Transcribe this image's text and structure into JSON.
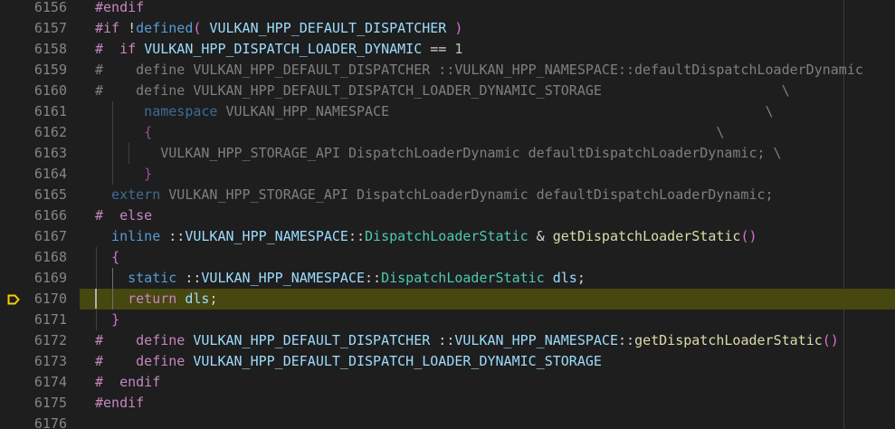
{
  "colors": {
    "background": "#1e1e1e",
    "current_line": "#474710",
    "line_number": "#858585",
    "debug_arrow": "#ffcc00"
  },
  "gutter": {
    "breakpoint_icon": "debug-stackframe-icon",
    "line_numbers": [
      "6156",
      "6157",
      "6158",
      "6159",
      "6160",
      "6161",
      "6162",
      "6163",
      "6164",
      "6165",
      "6166",
      "6167",
      "6168",
      "6169",
      "6170",
      "6171",
      "6172",
      "6173",
      "6174",
      "6175",
      "6176"
    ]
  },
  "lines": [
    {
      "tokens": [
        {
          "t": "#endif",
          "c": "#c586c0"
        }
      ]
    },
    {
      "tokens": [
        {
          "t": "#if",
          "c": "#c586c0"
        },
        {
          "t": " ",
          "c": "#d4d4d4"
        },
        {
          "t": "!",
          "c": "#d4d4d4"
        },
        {
          "t": "defined",
          "c": "#569cd6"
        },
        {
          "t": "(",
          "c": "#da70d6"
        },
        {
          "t": " VULKAN_HPP_DEFAULT_DISPATCHER ",
          "c": "#9cdcfe"
        },
        {
          "t": ")",
          "c": "#da70d6"
        }
      ]
    },
    {
      "tokens": [
        {
          "t": "#  if ",
          "c": "#c586c0"
        },
        {
          "t": "VULKAN_HPP_DISPATCH_LOADER_DYNAMIC",
          "c": "#9cdcfe"
        },
        {
          "t": " == ",
          "c": "#d4d4d4"
        },
        {
          "t": "1",
          "c": "#b5cea8"
        }
      ]
    },
    {
      "tokens": [
        {
          "t": "#    define VULKAN_HPP_DEFAULT_DISPATCHER ::VULKAN_HPP_NAMESPACE::defaultDispatchLoaderDynamic",
          "c": "#7f7f7f"
        }
      ]
    },
    {
      "tokens": [
        {
          "t": "#    define VULKAN_HPP_DEFAULT_DISPATCH_LOADER_DYNAMIC_STORAGE                      \\",
          "c": "#7f7f7f"
        }
      ]
    },
    {
      "tokens": [
        {
          "t": "      namespace ",
          "c": "#3d6c96"
        },
        {
          "t": "VULKAN_HPP_NAMESPACE                                              \\",
          "c": "#7f7f7f"
        }
      ]
    },
    {
      "tokens": [
        {
          "t": "      {",
          "c": "#9a4e9a"
        },
        {
          "t": "                                                                     \\",
          "c": "#7f7f7f"
        }
      ]
    },
    {
      "tokens": [
        {
          "t": "        VULKAN_HPP_STORAGE_API DispatchLoaderDynamic defaultDispatchLoaderDynamic; \\",
          "c": "#7f7f7f"
        }
      ]
    },
    {
      "tokens": [
        {
          "t": "      }",
          "c": "#9a4e9a"
        }
      ]
    },
    {
      "tokens": [
        {
          "t": "  extern ",
          "c": "#3d6c96"
        },
        {
          "t": "VULKAN_HPP_STORAGE_API DispatchLoaderDynamic defaultDispatchLoaderDynamic;",
          "c": "#7f7f7f"
        }
      ]
    },
    {
      "tokens": [
        {
          "t": "#  else",
          "c": "#c586c0"
        }
      ]
    },
    {
      "tokens": [
        {
          "t": "  inline ",
          "c": "#569cd6"
        },
        {
          "t": "::",
          "c": "#d4d4d4"
        },
        {
          "t": "VULKAN_HPP_NAMESPACE",
          "c": "#9cdcfe"
        },
        {
          "t": "::",
          "c": "#d4d4d4"
        },
        {
          "t": "DispatchLoaderStatic",
          "c": "#4ec9b0"
        },
        {
          "t": " & ",
          "c": "#d4d4d4"
        },
        {
          "t": "getDispatchLoaderStatic",
          "c": "#dcdcaa"
        },
        {
          "t": "()",
          "c": "#da70d6"
        }
      ]
    },
    {
      "tokens": [
        {
          "t": "  ",
          "c": "#d4d4d4"
        },
        {
          "t": "{",
          "c": "#da70d6"
        }
      ]
    },
    {
      "tokens": [
        {
          "t": "    static ",
          "c": "#569cd6"
        },
        {
          "t": "::",
          "c": "#d4d4d4"
        },
        {
          "t": "VULKAN_HPP_NAMESPACE",
          "c": "#9cdcfe"
        },
        {
          "t": "::",
          "c": "#d4d4d4"
        },
        {
          "t": "DispatchLoaderStatic",
          "c": "#4ec9b0"
        },
        {
          "t": " ",
          "c": "#d4d4d4"
        },
        {
          "t": "dls",
          "c": "#9cdcfe"
        },
        {
          "t": ";",
          "c": "#d4d4d4"
        }
      ]
    },
    {
      "tokens": [
        {
          "t": "    return ",
          "c": "#c586c0"
        },
        {
          "t": "dls",
          "c": "#9cdcfe"
        },
        {
          "t": ";",
          "c": "#d4d4d4"
        }
      ]
    },
    {
      "tokens": [
        {
          "t": "  ",
          "c": "#d4d4d4"
        },
        {
          "t": "}",
          "c": "#da70d6"
        }
      ]
    },
    {
      "tokens": [
        {
          "t": "#    define ",
          "c": "#c586c0"
        },
        {
          "t": "VULKAN_HPP_DEFAULT_DISPATCHER",
          "c": "#9cdcfe"
        },
        {
          "t": " ::",
          "c": "#d4d4d4"
        },
        {
          "t": "VULKAN_HPP_NAMESPACE",
          "c": "#9cdcfe"
        },
        {
          "t": "::",
          "c": "#d4d4d4"
        },
        {
          "t": "getDispatchLoaderStatic",
          "c": "#dcdcaa"
        },
        {
          "t": "()",
          "c": "#da70d6"
        }
      ]
    },
    {
      "tokens": [
        {
          "t": "#    define ",
          "c": "#c586c0"
        },
        {
          "t": "VULKAN_HPP_DEFAULT_DISPATCH_LOADER_DYNAMIC_STORAGE",
          "c": "#9cdcfe"
        }
      ]
    },
    {
      "tokens": [
        {
          "t": "#  endif",
          "c": "#c586c0"
        }
      ]
    },
    {
      "tokens": [
        {
          "t": "#endif",
          "c": "#c586c0"
        }
      ]
    },
    {
      "tokens": []
    }
  ]
}
